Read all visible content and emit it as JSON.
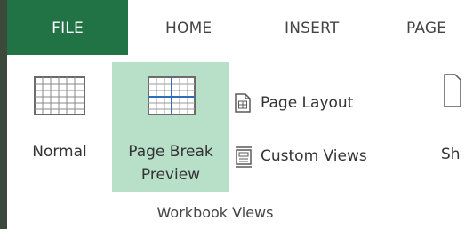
{
  "tabs": {
    "file": "FILE",
    "home": "HOME",
    "insert": "INSERT",
    "page_partial": "PAGE"
  },
  "ribbon": {
    "normal_label": "Normal",
    "page_break_line1": "Page Break",
    "page_break_line2": "Preview",
    "page_layout_label": "Page Layout",
    "custom_views_label": "Custom Views",
    "group_label": "Workbook Views",
    "next_group_partial": "Sh"
  },
  "colors": {
    "file_tab_bg": "#217346",
    "selected_button_bg": "#b8dfc8",
    "left_edge": "#3c4a3c"
  },
  "icons": {
    "normal": "grid-sheet-icon",
    "page_break_preview": "page-break-sheet-icon",
    "page_layout": "page-layout-icon",
    "custom_views": "custom-views-icon"
  }
}
